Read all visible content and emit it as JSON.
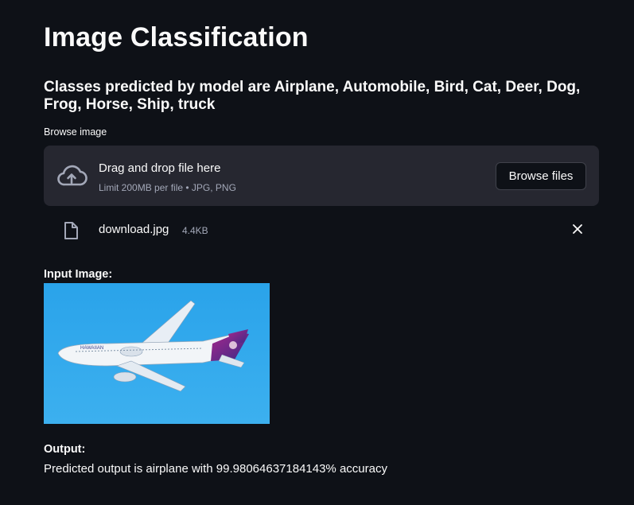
{
  "page": {
    "title": "Image Classification",
    "subtitle": "Classes predicted by model are Airplane, Automobile, Bird, Cat, Deer, Dog, Frog, Horse, Ship, truck"
  },
  "uploader": {
    "label": "Browse image",
    "drop_text": "Drag and drop file here",
    "limit_text": "Limit 200MB per file • JPG, PNG",
    "browse_button": "Browse files",
    "icon": "cloud-upload-icon"
  },
  "uploaded_file": {
    "name": "download.jpg",
    "size": "4.4KB",
    "icon": "file-icon",
    "remove_icon": "close-icon"
  },
  "input_section": {
    "label": "Input Image:",
    "image_subject": "airplane",
    "image_text": "HAWAIIAN"
  },
  "output_section": {
    "label": "Output:",
    "text": "Predicted output is airplane with 99.98064637184143% accuracy"
  },
  "colors": {
    "background": "#0e1117",
    "dropzone": "#262730",
    "text": "#fafafa",
    "muted_text": "#a3a8b8",
    "sky": "#2fa4e8"
  }
}
